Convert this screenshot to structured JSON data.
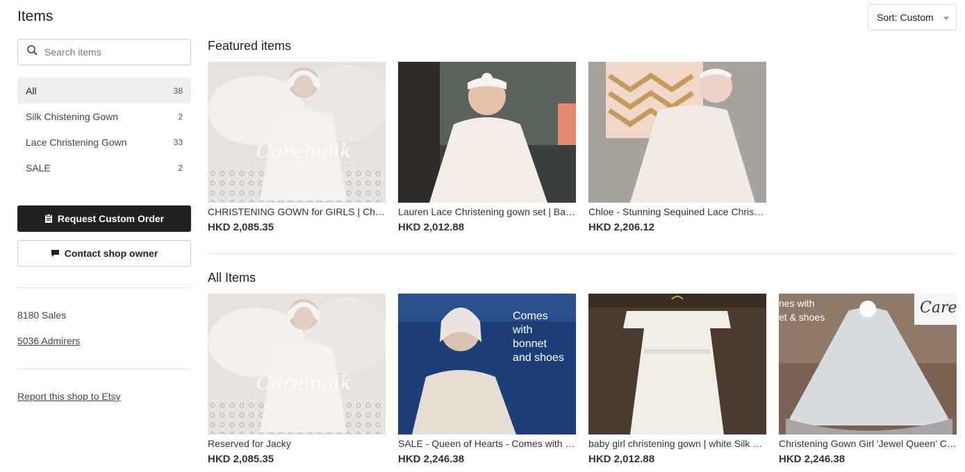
{
  "header": {
    "title": "Items",
    "sort_label": "Sort: Custom"
  },
  "search": {
    "placeholder": "Search items"
  },
  "sections": [
    {
      "label": "All",
      "count": "38",
      "active": true
    },
    {
      "label": "Silk Chistening Gown",
      "count": "2"
    },
    {
      "label": "Lace Christening Gown",
      "count": "33"
    },
    {
      "label": "SALE",
      "count": "2"
    }
  ],
  "actions": {
    "custom_order": "Request Custom Order",
    "contact": "Contact shop owner"
  },
  "stats": {
    "sales": "8180 Sales",
    "admirers": "5036 Admirers"
  },
  "report": "Report this shop to Etsy",
  "featured": {
    "heading": "Featured items",
    "items": [
      {
        "title": "CHRISTENING GOWN for GIRLS | Christening dress",
        "price": "HKD 2,085.35",
        "watermark": "Caremaik"
      },
      {
        "title": "Lauren Lace Christening gown set | Baptism dress",
        "price": "HKD 2,012.88"
      },
      {
        "title": "Chloe - Stunning Sequined Lace Christening Gown",
        "price": "HKD 2,206.12"
      }
    ]
  },
  "all_items": {
    "heading": "All Items",
    "items": [
      {
        "title": "Reserved for Jacky",
        "price": "HKD 2,085.35",
        "watermark": "Caremaik"
      },
      {
        "title": "SALE - Queen of Hearts - Comes with bonnet and shoes",
        "price": "HKD 2,246.38",
        "overlay": [
          "Comes",
          "with",
          "bonnet",
          "and shoes"
        ]
      },
      {
        "title": "baby girl christening gown | white Silk christening",
        "price": "HKD 2,012.88"
      },
      {
        "title": "Christening Gown Girl 'Jewel Queen' Christening Dress",
        "price": "HKD 2,246.38",
        "overlay": [
          "nes with",
          "et & shoes"
        ],
        "logo": "Carem"
      }
    ]
  },
  "colors": {
    "primary_button": "#222222",
    "active_section": "#eeeeee",
    "divider": "#e1e1e1"
  },
  "icons": {
    "search": "search-icon",
    "custom_order": "clipboard-icon",
    "contact": "message-icon",
    "sort": "caret-down-icon"
  }
}
